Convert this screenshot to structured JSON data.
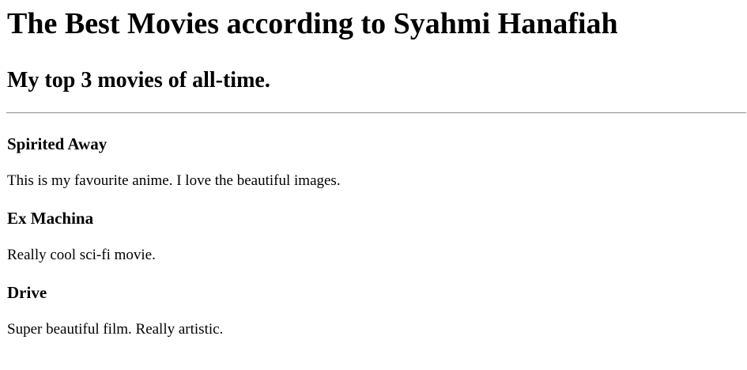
{
  "page": {
    "title": "The Best Movies according to Syahmi Hanafiah",
    "subtitle": "My top 3 movies of all-time."
  },
  "movies": [
    {
      "name": "Spirited Away",
      "description": "This is my favourite anime. I love the beautiful images."
    },
    {
      "name": "Ex Machina",
      "description": "Really cool sci-fi movie."
    },
    {
      "name": "Drive",
      "description": "Super beautiful film. Really artistic."
    }
  ]
}
